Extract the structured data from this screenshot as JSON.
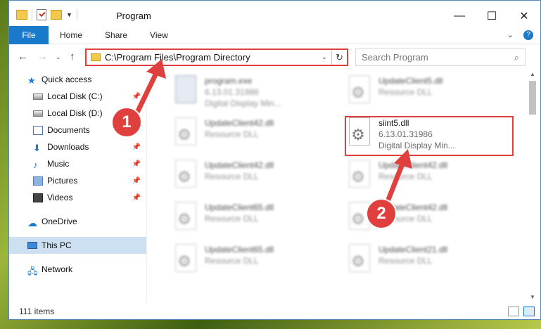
{
  "window": {
    "title": "Program",
    "controls": {
      "minimize": "—",
      "maximize": "☐",
      "close": "✕"
    }
  },
  "ribbon": {
    "tabs": [
      "File",
      "Home",
      "Share",
      "View"
    ]
  },
  "address": {
    "path": "C:\\Program Files\\Program Directory",
    "search_placeholder": "Search Program"
  },
  "sidebar": {
    "items": [
      {
        "label": "Quick access",
        "icon": "star-icon"
      },
      {
        "label": "Local Disk (C:)",
        "icon": "disk-icon"
      },
      {
        "label": "Local Disk (D:)",
        "icon": "disk-icon"
      },
      {
        "label": "Documents",
        "icon": "documents-icon"
      },
      {
        "label": "Downloads",
        "icon": "downloads-icon"
      },
      {
        "label": "Music",
        "icon": "music-icon"
      },
      {
        "label": "Pictures",
        "icon": "pictures-icon"
      },
      {
        "label": "Videos",
        "icon": "videos-icon"
      },
      {
        "label": "OneDrive",
        "icon": "cloud-icon"
      },
      {
        "label": "This PC",
        "icon": "pc-icon"
      },
      {
        "label": "Network",
        "icon": "network-icon"
      }
    ]
  },
  "files": [
    {
      "name": "program.exe",
      "line2": "6.13.01.31986",
      "line3": "Digital Display Min..."
    },
    {
      "name": "UpdateClient5.dll",
      "line2": "Resource DLL",
      "line3": ""
    },
    {
      "name": "UpdateClient42.dll",
      "line2": "Resource DLL",
      "line3": ""
    },
    {
      "name": "siint5.dll",
      "line2": "6.13.01.31986",
      "line3": "Digital Display Min..."
    },
    {
      "name": "UpdateClient42.dll",
      "line2": "Resource DLL",
      "line3": ""
    },
    {
      "name": "UpdateClient42.dll",
      "line2": "Resource DLL",
      "line3": ""
    },
    {
      "name": "UpdateClient65.dll",
      "line2": "Resource DLL",
      "line3": ""
    },
    {
      "name": "UpdateClient42.dll",
      "line2": "Resource DLL",
      "line3": ""
    },
    {
      "name": "UpdateClient65.dll",
      "line2": "Resource DLL",
      "line3": ""
    },
    {
      "name": "UpdateClient21.dll",
      "line2": "Resource DLL",
      "line3": ""
    }
  ],
  "status": {
    "item_count": "111 items"
  },
  "annotations": {
    "step1": "1",
    "step2": "2",
    "color": "#e0403d"
  }
}
